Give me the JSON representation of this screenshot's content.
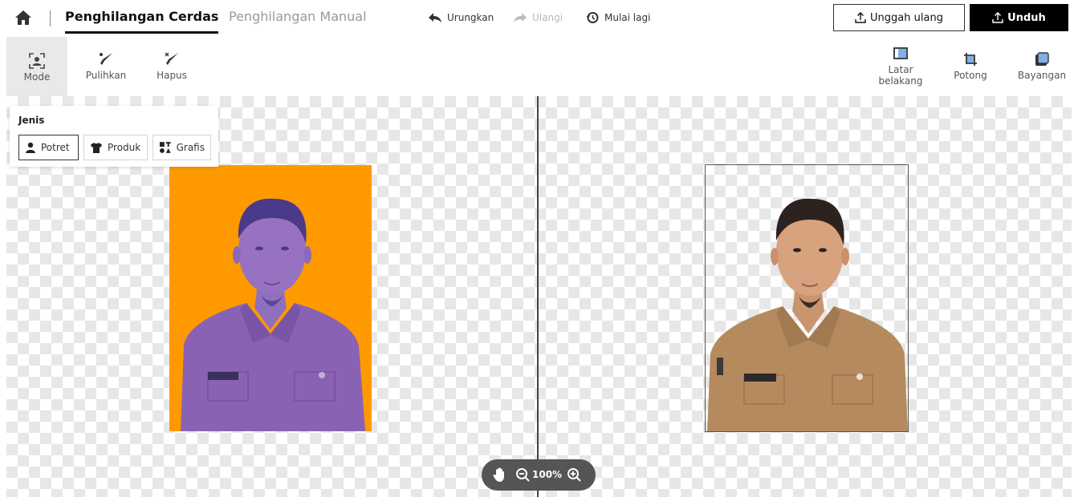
{
  "header": {
    "tab_smart": "Penghilangan Cerdas",
    "tab_manual": "Penghilangan Manual",
    "undo_label": "Urungkan",
    "redo_label": "Ulangi",
    "reset_label": "Mulai lagi",
    "reupload_label": "Unggah ulang",
    "download_label": "Unduh"
  },
  "toolbar": {
    "mode_label": "Mode",
    "restore_label": "Pulihkan",
    "erase_label": "Hapus",
    "background_label_line1": "Latar",
    "background_label_line2": "belakang",
    "crop_label": "Potong",
    "shadow_label": "Bayangan"
  },
  "type_panel": {
    "title": "Jenis",
    "options": [
      "Potret",
      "Produk",
      "Grafis"
    ],
    "selected": "Potret"
  },
  "zoom": {
    "value": "100%"
  },
  "colors": {
    "original_background": "#ff9900",
    "mask_overlay": "#8060c0",
    "uniform": "#b58a5e"
  },
  "icons": [
    "home-icon",
    "undo-icon",
    "redo-icon",
    "history-icon",
    "upload-icon",
    "download-icon",
    "mode-icon",
    "restore-icon",
    "erase-icon",
    "background-icon",
    "crop-icon",
    "shadow-icon",
    "person-icon",
    "shirt-icon",
    "graphics-icon",
    "hand-icon",
    "zoom-out-icon",
    "zoom-in-icon"
  ]
}
